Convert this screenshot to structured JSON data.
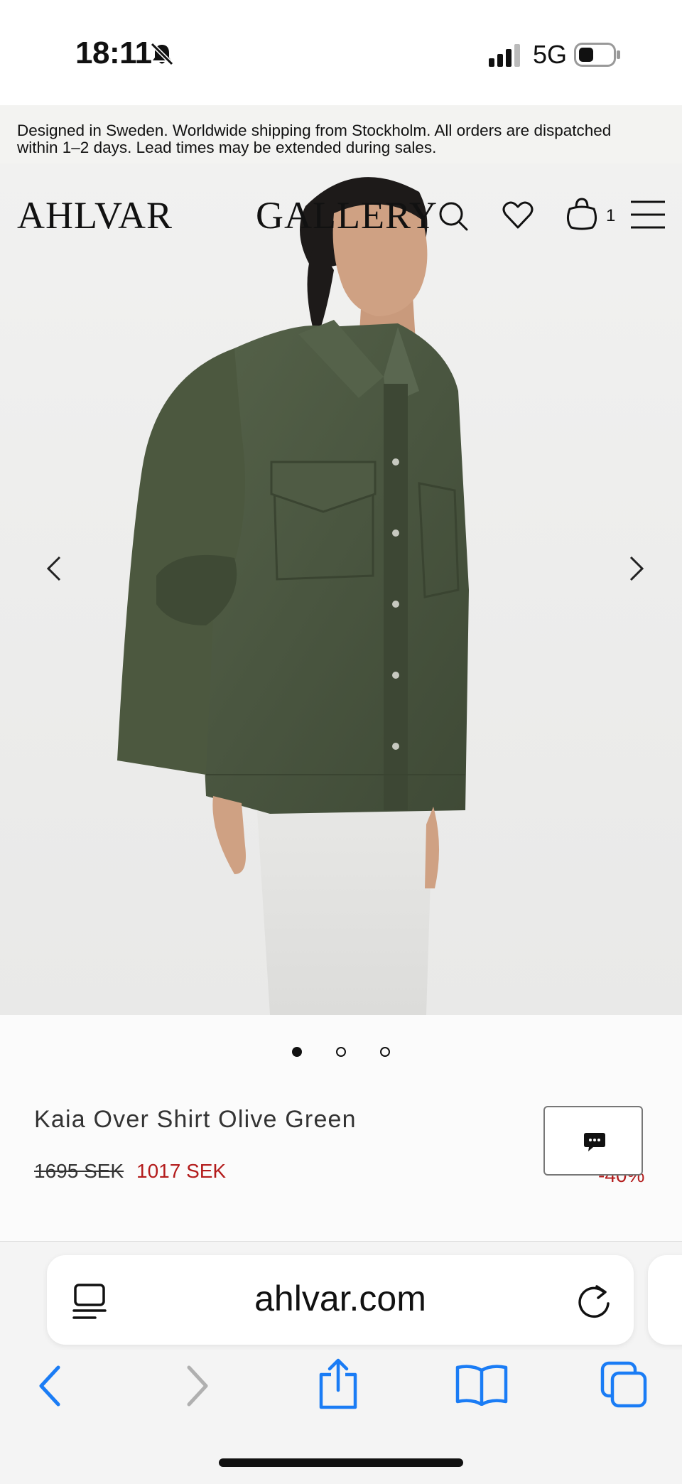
{
  "status": {
    "time": "18:11",
    "network": "5G"
  },
  "announcement": {
    "text": "Designed in Sweden. Worldwide shipping from Stockholm. All orders are dispatched within 1–2 days. Lead times may be extended during sales."
  },
  "header": {
    "logo": "AHLVAR",
    "brand_secondary": "GALLERY",
    "cart_count": "1",
    "icons": [
      "search-icon",
      "heart-icon",
      "bag-icon",
      "menu-icon"
    ]
  },
  "gallery": {
    "active_index": 0,
    "count": 3
  },
  "product": {
    "name": "Kaia Over Shirt Olive Green",
    "price_original": "1695 SEK",
    "price_sale": "1017 SEK",
    "discount": "-40%",
    "sale_color": "#b31b1b"
  },
  "browser": {
    "url": "ahlvar.com",
    "accent_color": "#1a7cf5",
    "toolbar_icons": [
      "back-icon",
      "forward-icon",
      "share-icon",
      "bookmarks-icon",
      "tabs-icon"
    ]
  }
}
